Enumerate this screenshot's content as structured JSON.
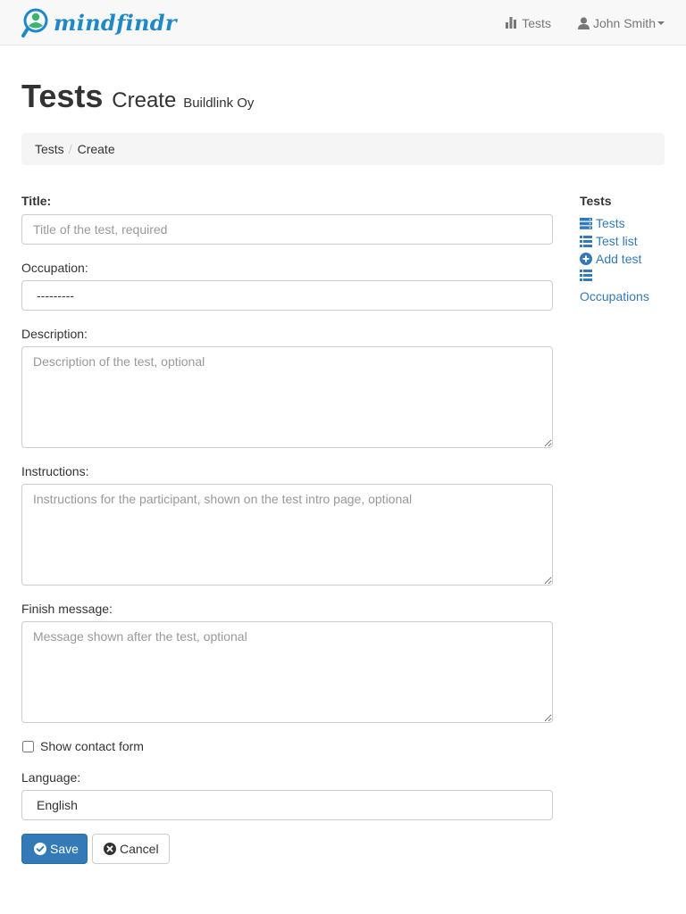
{
  "brand": {
    "name": "mindfindr",
    "accent_color": "#1e88c8",
    "icon": "person-search-icon"
  },
  "nav": {
    "tests_label": "Tests",
    "tests_icon": "bar-chart-icon",
    "user_label": "John Smith",
    "user_icon": "user-icon"
  },
  "page": {
    "title": "Tests",
    "subtitle": "Create",
    "context": "Buildlink Oy"
  },
  "breadcrumb": {
    "items": [
      "Tests",
      "Create"
    ],
    "separator": "/"
  },
  "form": {
    "title": {
      "label": "Title:",
      "placeholder": "Title of the test, required"
    },
    "occupation": {
      "label": "Occupation:",
      "value": "---------"
    },
    "description": {
      "label": "Description:",
      "placeholder": "Description of the test, optional"
    },
    "instructions": {
      "label": "Instructions:",
      "placeholder": "Instructions for the participant, shown on the test intro page, optional"
    },
    "finish_message": {
      "label": "Finish message:",
      "placeholder": "Message shown after the test, optional"
    },
    "show_contact_form": {
      "label": "Show contact form",
      "checked": false
    },
    "language": {
      "label": "Language:",
      "value": "English"
    },
    "save_label": "Save",
    "cancel_label": "Cancel"
  },
  "sidebar": {
    "title": "Tests",
    "items": [
      {
        "label": "Tests",
        "icon": "server-stack-icon"
      },
      {
        "label": "Test list",
        "icon": "list-icon"
      },
      {
        "label": "Add test",
        "icon": "plus-circle-icon"
      },
      {
        "label": "Occupations",
        "icon": "list-icon"
      }
    ]
  },
  "colors": {
    "primary": "#337ab7",
    "navbar_bg": "#f8f8f8",
    "breadcrumb_bg": "#f5f5f5"
  }
}
